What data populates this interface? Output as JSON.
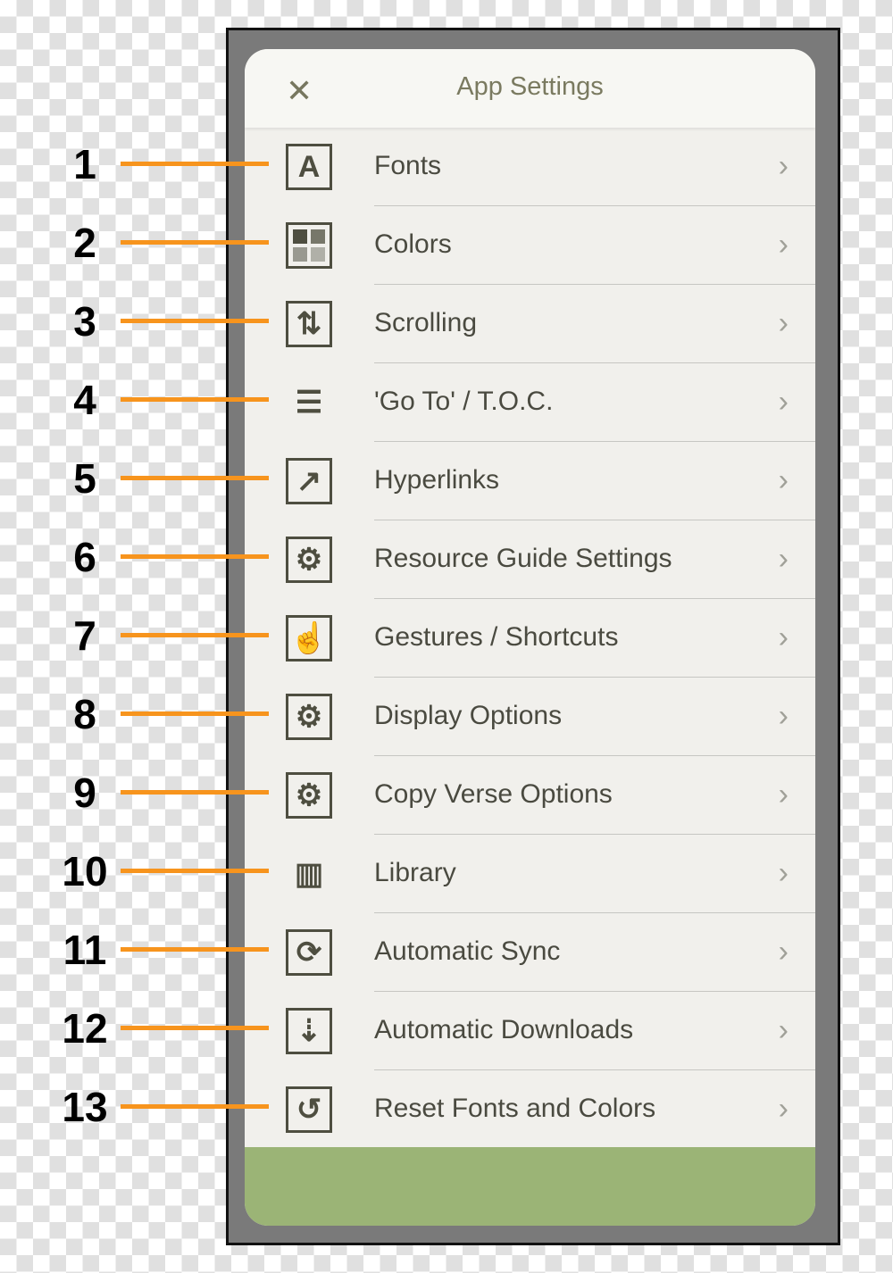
{
  "header": {
    "title": "App Settings",
    "close_icon": "close-icon"
  },
  "items": [
    {
      "num": "1",
      "label": "Fonts",
      "icon": "font-size-icon",
      "glyph": "A"
    },
    {
      "num": "2",
      "label": "Colors",
      "icon": "color-grid-icon",
      "glyph": ""
    },
    {
      "num": "3",
      "label": "Scrolling",
      "icon": "scroll-settings-icon",
      "glyph": "⇅"
    },
    {
      "num": "4",
      "label": "'Go To' / T.O.C.",
      "icon": "toc-icon",
      "glyph": "☰"
    },
    {
      "num": "5",
      "label": "Hyperlinks",
      "icon": "hyperlink-icon",
      "glyph": "↗"
    },
    {
      "num": "6",
      "label": "Resource Guide Settings",
      "icon": "resource-guide-icon",
      "glyph": "⚙"
    },
    {
      "num": "7",
      "label": "Gestures / Shortcuts",
      "icon": "gesture-hand-icon",
      "glyph": "☝"
    },
    {
      "num": "8",
      "label": "Display Options",
      "icon": "display-icon",
      "glyph": "⚙"
    },
    {
      "num": "9",
      "label": "Copy Verse Options",
      "icon": "copy-verse-icon",
      "glyph": "⚙"
    },
    {
      "num": "10",
      "label": "Library",
      "icon": "library-icon",
      "glyph": "▥"
    },
    {
      "num": "11",
      "label": "Automatic Sync",
      "icon": "sync-icon",
      "glyph": "⟳"
    },
    {
      "num": "12",
      "label": "Automatic Downloads",
      "icon": "download-icon",
      "glyph": "⇣"
    },
    {
      "num": "13",
      "label": "Reset Fonts and Colors",
      "icon": "reset-icon",
      "glyph": "↺"
    }
  ],
  "colors": {
    "accent": "#f7941d",
    "footer": "#9bb476",
    "text": "#4a4a40"
  }
}
